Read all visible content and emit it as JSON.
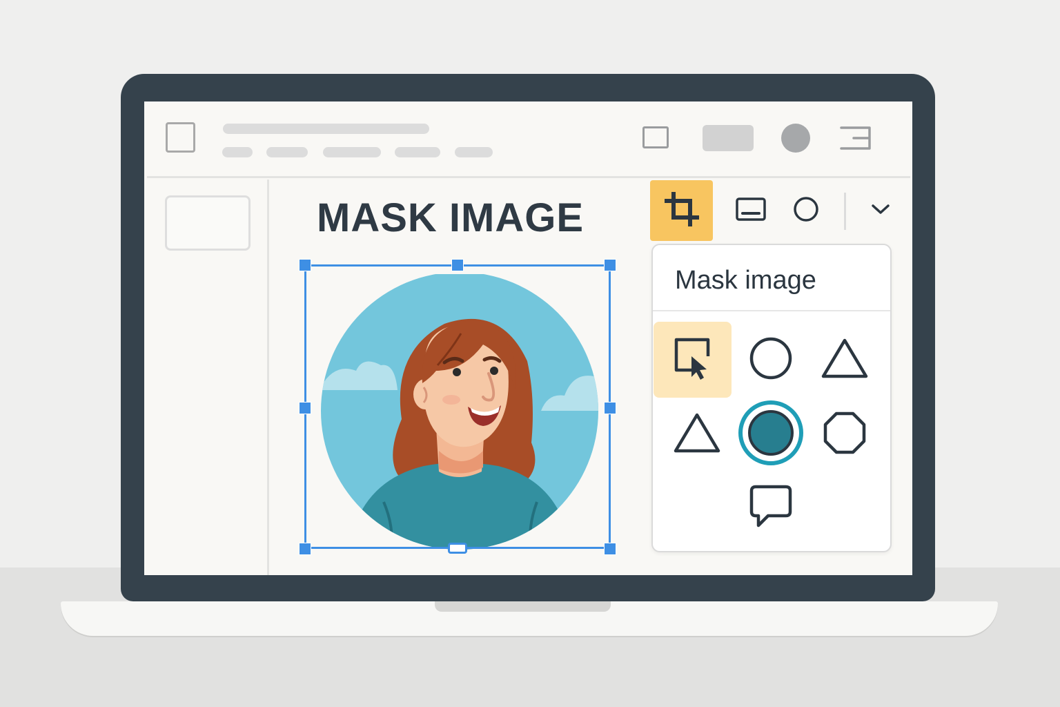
{
  "editor": {
    "slide_title": "MASK IMAGE"
  },
  "toolbar": {
    "items": [
      {
        "icon": "crop-icon",
        "active": true
      },
      {
        "icon": "frame-icon",
        "active": false
      },
      {
        "icon": "circle-icon",
        "active": false
      },
      {
        "icon": "chevron-down-icon",
        "active": false
      }
    ]
  },
  "mask_panel": {
    "title": "Mask image",
    "shapes": [
      {
        "icon": "square-cursor-icon",
        "selected": true
      },
      {
        "icon": "circle-shape-icon",
        "selected": false
      },
      {
        "icon": "triangle-shape-icon",
        "selected": false
      },
      {
        "icon": "triangle-shape-icon",
        "selected": false
      },
      {
        "icon": "filled-circle-shape-icon",
        "selected": false
      },
      {
        "icon": "octagon-shape-icon",
        "selected": false
      },
      {
        "icon": "speech-bubble-shape-icon",
        "selected": false
      }
    ]
  },
  "colors": {
    "accent": "#f8c560",
    "selection": "#3e8fe4",
    "bezel": "#35424c",
    "teal": "#1f9eb7"
  }
}
